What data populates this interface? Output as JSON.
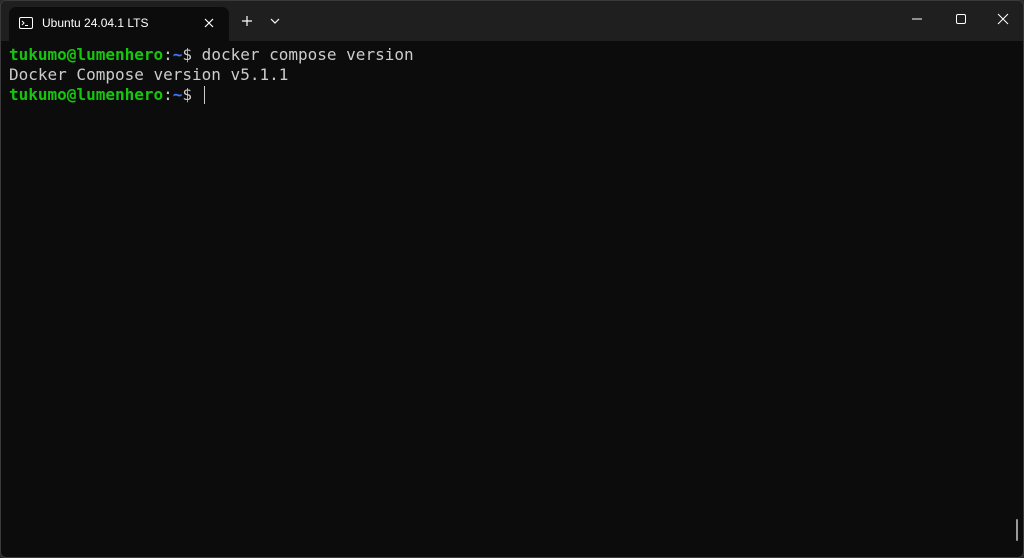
{
  "window": {
    "tab_title": "Ubuntu 24.04.1 LTS",
    "tab_icon": "terminal-icon",
    "new_tab_icon": "plus-icon",
    "dropdown_icon": "chevron-down-icon",
    "controls": [
      "minimize-icon",
      "maximize-icon",
      "close-icon"
    ]
  },
  "terminal": {
    "lines": [
      {
        "user_host": "tukumo@lumenhero",
        "separator": ":",
        "path": "~",
        "prompt": "$",
        "command": " docker compose version"
      },
      {
        "output": "Docker Compose version v5.1.1"
      },
      {
        "user_host": "tukumo@lumenhero",
        "separator": ":",
        "path": "~",
        "prompt": "$",
        "command": " "
      }
    ]
  },
  "colors": {
    "background": "#0c0c0c",
    "titlebar": "#1f1f1f",
    "user_host": "#16c60c",
    "path": "#3b78ff",
    "text": "#cccccc"
  }
}
